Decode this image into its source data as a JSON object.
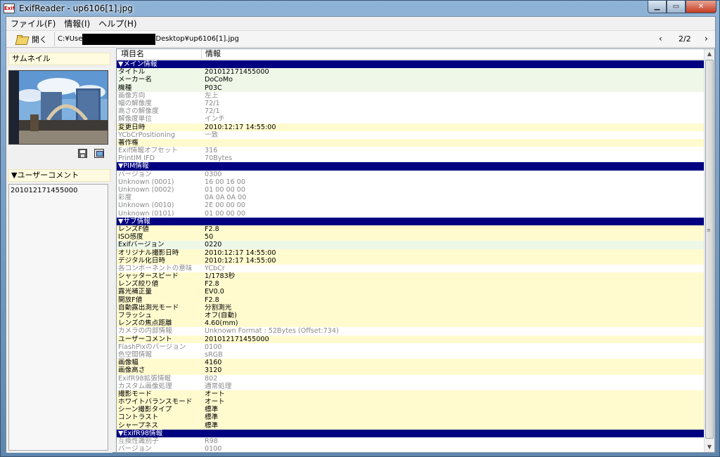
{
  "window": {
    "title": "ExifReader - up6106[1].jpg",
    "icon_text": "Exif"
  },
  "menu": [
    "ファイル(F)",
    "情報(I)",
    "ヘルプ(H)"
  ],
  "toolbar": {
    "open_label": "開く",
    "path_prefix": "C:¥Use",
    "path_suffix": "Desktop¥up6106[1].jpg",
    "prev": "‹",
    "next": "›",
    "page_counter": "2/2"
  },
  "sidebar": {
    "thumbnail_header": "サムネイル",
    "user_comment_header": "▼ユーザーコメント",
    "user_comment_value": "201012171455000"
  },
  "columns": {
    "name": "項目名",
    "value": "情報"
  },
  "rows": [
    {
      "t": "section",
      "k": "▼メイン情報",
      "v": ""
    },
    {
      "t": "green",
      "k": "タイトル",
      "v": "201012171455000"
    },
    {
      "t": "green",
      "k": "メーカー名",
      "v": "DoCoMo"
    },
    {
      "t": "green",
      "k": "機種",
      "v": "P03C"
    },
    {
      "t": "gray",
      "k": "画像方向",
      "v": "左上"
    },
    {
      "t": "gray",
      "k": "幅の解像度",
      "v": "72/1"
    },
    {
      "t": "gray",
      "k": "高さの解像度",
      "v": "72/1"
    },
    {
      "t": "gray",
      "k": "解像度単位",
      "v": "インチ"
    },
    {
      "t": "yellow",
      "k": "変更日時",
      "v": "2010:12:17 14:55:00"
    },
    {
      "t": "gray",
      "k": "YCbCrPositioning",
      "v": "一致"
    },
    {
      "t": "yellow",
      "k": "著作権",
      "v": ""
    },
    {
      "t": "gray",
      "k": "Exif情報オフセット",
      "v": "316"
    },
    {
      "t": "gray",
      "k": "PrintIM IFD",
      "v": "70Bytes"
    },
    {
      "t": "section",
      "k": "▼PIM情報",
      "v": ""
    },
    {
      "t": "gray",
      "k": "バージョン",
      "v": "0300"
    },
    {
      "t": "gray",
      "k": "Unknown (0001)",
      "v": "16 00 16 00"
    },
    {
      "t": "gray",
      "k": "Unknown (0002)",
      "v": "01 00 00 00"
    },
    {
      "t": "gray",
      "k": "彩度",
      "v": "0A 0A 0A 00"
    },
    {
      "t": "gray",
      "k": "Unknown (0010)",
      "v": "2E 00 00 00"
    },
    {
      "t": "gray",
      "k": "Unknown (0101)",
      "v": "01 00 00 00"
    },
    {
      "t": "section",
      "k": "▼サブ情報",
      "v": ""
    },
    {
      "t": "yellow",
      "k": "レンズF値",
      "v": "F2.8"
    },
    {
      "t": "yellow",
      "k": "ISO感度",
      "v": "50"
    },
    {
      "t": "green",
      "k": "Exifバージョン",
      "v": "0220"
    },
    {
      "t": "yellow",
      "k": "オリジナル撮影日時",
      "v": "2010:12:17 14:55:00"
    },
    {
      "t": "yellow",
      "k": "デジタル化日時",
      "v": "2010:12:17 14:55:00"
    },
    {
      "t": "gray",
      "k": "各コンポーネントの意味",
      "v": "YCbCr"
    },
    {
      "t": "yellow",
      "k": "シャッタースピード",
      "v": "1/1783秒"
    },
    {
      "t": "yellow",
      "k": "レンズ絞り値",
      "v": "F2.8"
    },
    {
      "t": "yellow",
      "k": "露光補正量",
      "v": "EV0.0"
    },
    {
      "t": "yellow",
      "k": "開放F値",
      "v": "F2.8"
    },
    {
      "t": "yellow",
      "k": "自動露出測光モード",
      "v": "分割測光"
    },
    {
      "t": "yellow",
      "k": "フラッシュ",
      "v": "オフ(自動)"
    },
    {
      "t": "yellow",
      "k": "レンズの焦点距離",
      "v": "4.60(mm)"
    },
    {
      "t": "gray",
      "k": "カメラの内部情報",
      "v": "Unknown Format : 52Bytes (Offset:734)"
    },
    {
      "t": "yellow",
      "k": "ユーザーコメント",
      "v": "201012171455000"
    },
    {
      "t": "gray",
      "k": "FlashPixのバージョン",
      "v": "0100"
    },
    {
      "t": "gray",
      "k": "色空間情報",
      "v": "sRGB"
    },
    {
      "t": "yellow",
      "k": "画像幅",
      "v": "4160"
    },
    {
      "t": "yellow",
      "k": "画像高さ",
      "v": "3120"
    },
    {
      "t": "gray",
      "k": "ExifR98拡張情報",
      "v": "802"
    },
    {
      "t": "gray",
      "k": "カスタム画像処理",
      "v": "通常処理"
    },
    {
      "t": "yellow",
      "k": "撮影モード",
      "v": "オート"
    },
    {
      "t": "yellow",
      "k": "ホワイトバランスモード",
      "v": "オート"
    },
    {
      "t": "yellow",
      "k": "シーン撮影タイプ",
      "v": "標準"
    },
    {
      "t": "yellow",
      "k": "コントラスト",
      "v": "標準"
    },
    {
      "t": "yellow",
      "k": "シャープネス",
      "v": "標準"
    },
    {
      "t": "section",
      "k": "▼ExifR98情報",
      "v": ""
    },
    {
      "t": "gray",
      "k": "互換性識別子",
      "v": "R98"
    },
    {
      "t": "gray",
      "k": "バージョン",
      "v": "0100"
    }
  ]
}
